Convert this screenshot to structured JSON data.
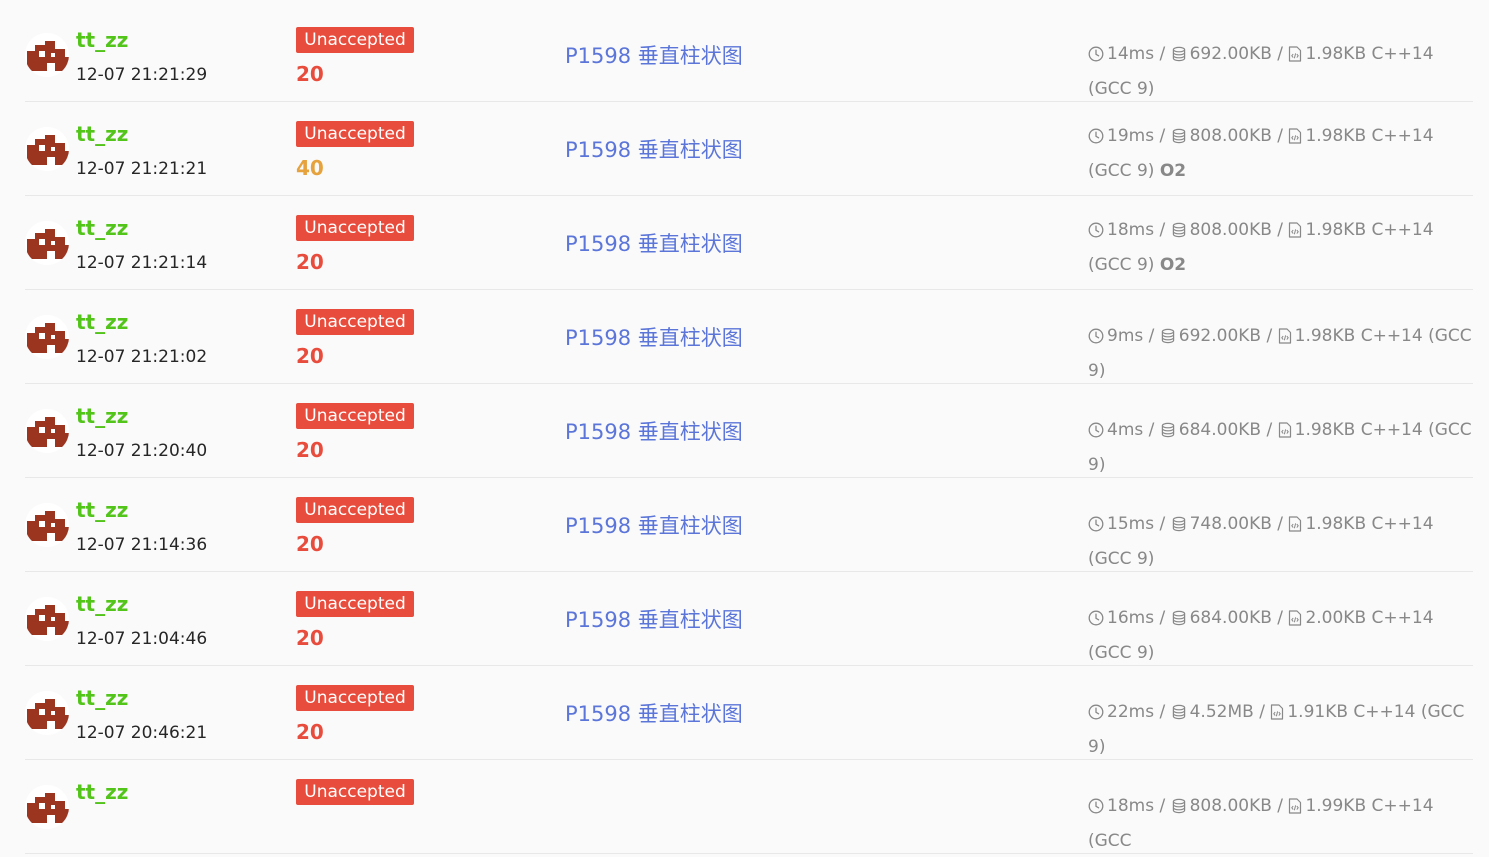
{
  "colors": {
    "user": "#52c41a",
    "status_bg": "#e74c3c",
    "score_low": "#e74c3c",
    "score_mid": "#e6a23c",
    "link": "#5b75d9",
    "meta": "#888888",
    "avatar": "#9b3520"
  },
  "icons": {
    "time": "clock-icon",
    "memory": "database-icon",
    "code": "code-file-icon"
  },
  "records": [
    {
      "user": "tt_zz",
      "time": "12-07 21:21:29",
      "status": "Unaccepted",
      "score": "20",
      "score_color": "#e74c3c",
      "problem": "P1598 垂直柱状图",
      "duration": "14ms",
      "memory": "692.00KB",
      "code_size": "1.98KB",
      "language": "C++14 (GCC 9)",
      "o2": ""
    },
    {
      "user": "tt_zz",
      "time": "12-07 21:21:21",
      "status": "Unaccepted",
      "score": "40",
      "score_color": "#e6a23c",
      "problem": "P1598 垂直柱状图",
      "duration": "19ms",
      "memory": "808.00KB",
      "code_size": "1.98KB",
      "language": "C++14 (GCC 9)",
      "o2": "O2"
    },
    {
      "user": "tt_zz",
      "time": "12-07 21:21:14",
      "status": "Unaccepted",
      "score": "20",
      "score_color": "#e74c3c",
      "problem": "P1598 垂直柱状图",
      "duration": "18ms",
      "memory": "808.00KB",
      "code_size": "1.98KB",
      "language": "C++14 (GCC 9)",
      "o2": "O2"
    },
    {
      "user": "tt_zz",
      "time": "12-07 21:21:02",
      "status": "Unaccepted",
      "score": "20",
      "score_color": "#e74c3c",
      "problem": "P1598 垂直柱状图",
      "duration": "9ms",
      "memory": "692.00KB",
      "code_size": "1.98KB",
      "language": "C++14 (GCC 9)",
      "o2": ""
    },
    {
      "user": "tt_zz",
      "time": "12-07 21:20:40",
      "status": "Unaccepted",
      "score": "20",
      "score_color": "#e74c3c",
      "problem": "P1598 垂直柱状图",
      "duration": "4ms",
      "memory": "684.00KB",
      "code_size": "1.98KB",
      "language": "C++14 (GCC 9)",
      "o2": ""
    },
    {
      "user": "tt_zz",
      "time": "12-07 21:14:36",
      "status": "Unaccepted",
      "score": "20",
      "score_color": "#e74c3c",
      "problem": "P1598 垂直柱状图",
      "duration": "15ms",
      "memory": "748.00KB",
      "code_size": "1.98KB",
      "language": "C++14 (GCC 9)",
      "o2": ""
    },
    {
      "user": "tt_zz",
      "time": "12-07 21:04:46",
      "status": "Unaccepted",
      "score": "20",
      "score_color": "#e74c3c",
      "problem": "P1598 垂直柱状图",
      "duration": "16ms",
      "memory": "684.00KB",
      "code_size": "2.00KB",
      "language": "C++14 (GCC 9)",
      "o2": ""
    },
    {
      "user": "tt_zz",
      "time": "12-07 20:46:21",
      "status": "Unaccepted",
      "score": "20",
      "score_color": "#e74c3c",
      "problem": "P1598 垂直柱状图",
      "duration": "22ms",
      "memory": "4.52MB",
      "code_size": "1.91KB",
      "language": "C++14 (GCC 9)",
      "o2": ""
    },
    {
      "user": "tt_zz",
      "time": "",
      "status": "Unaccepted",
      "score": "",
      "score_color": "#e74c3c",
      "problem": "",
      "duration": "18ms",
      "memory": "808.00KB",
      "code_size": "1.99KB",
      "language": "C++14 (GCC",
      "o2": ""
    }
  ]
}
